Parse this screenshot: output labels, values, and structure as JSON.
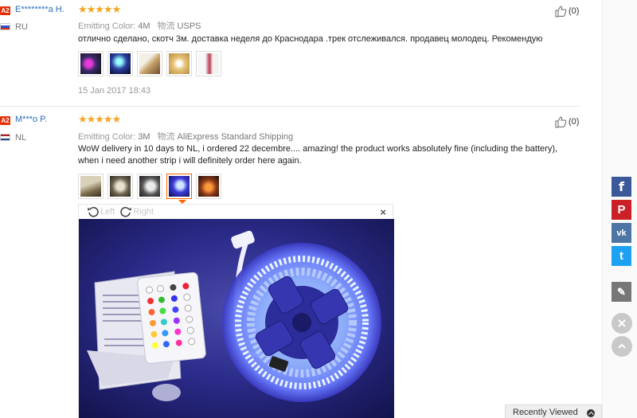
{
  "reviews": [
    {
      "level": "A2",
      "user": "E********a H.",
      "country": "RU",
      "flag_colors": [
        "#ffffff",
        "#2b50c8",
        "#d52b1e"
      ],
      "stars": "★★★★★",
      "helpful": "(0)",
      "emitting_color_label": "Emitting Color:",
      "emitting_color_value": "4M",
      "shipping_label": "物流",
      "shipping_value": "USPS",
      "text": "отлично сделано, скотч 3м. доставка неделя до Краснодара .трек отслеживался. продавец молодец. Рекомендую",
      "date": "15 Jan 2017 18:43",
      "photos": [
        "photo-1",
        "photo-2",
        "photo-3",
        "photo-4",
        "photo-5"
      ]
    },
    {
      "level": "A2",
      "user": "M***o P.",
      "country": "NL",
      "flag_colors": [
        "#ae1c28",
        "#ffffff",
        "#21468b"
      ],
      "stars": "★★★★★",
      "helpful": "(0)",
      "emitting_color_label": "Emitting Color:",
      "emitting_color_value": "3M",
      "shipping_label": "物流",
      "shipping_value": "AliExpress Standard Shipping",
      "text": "WoW delivery in 10 days to NL, i ordered 22 decembre.... amazing! the product works absolutely fine (including the battery), when i need another strip i will definitely order here again.",
      "photos": [
        "photo-1",
        "photo-2",
        "photo-3",
        "photo-4",
        "photo-5"
      ],
      "active_photo": 3
    }
  ],
  "viewer": {
    "rotate_left": "Left",
    "rotate_right": "Right",
    "close": "×"
  },
  "share": {
    "facebook": "f",
    "pinterest": "P",
    "vk": "vk",
    "twitter": "t",
    "edit": "✎"
  },
  "recently_viewed": "Recently Viewed",
  "colors": {
    "brand_link": "#2a6ebb",
    "star": "#f5a623",
    "badge": "#e62e04",
    "facebook": "#3b5998",
    "pinterest": "#cb2027",
    "vk": "#4c75a3",
    "twitter": "#1da1f2",
    "edit": "#777777"
  }
}
